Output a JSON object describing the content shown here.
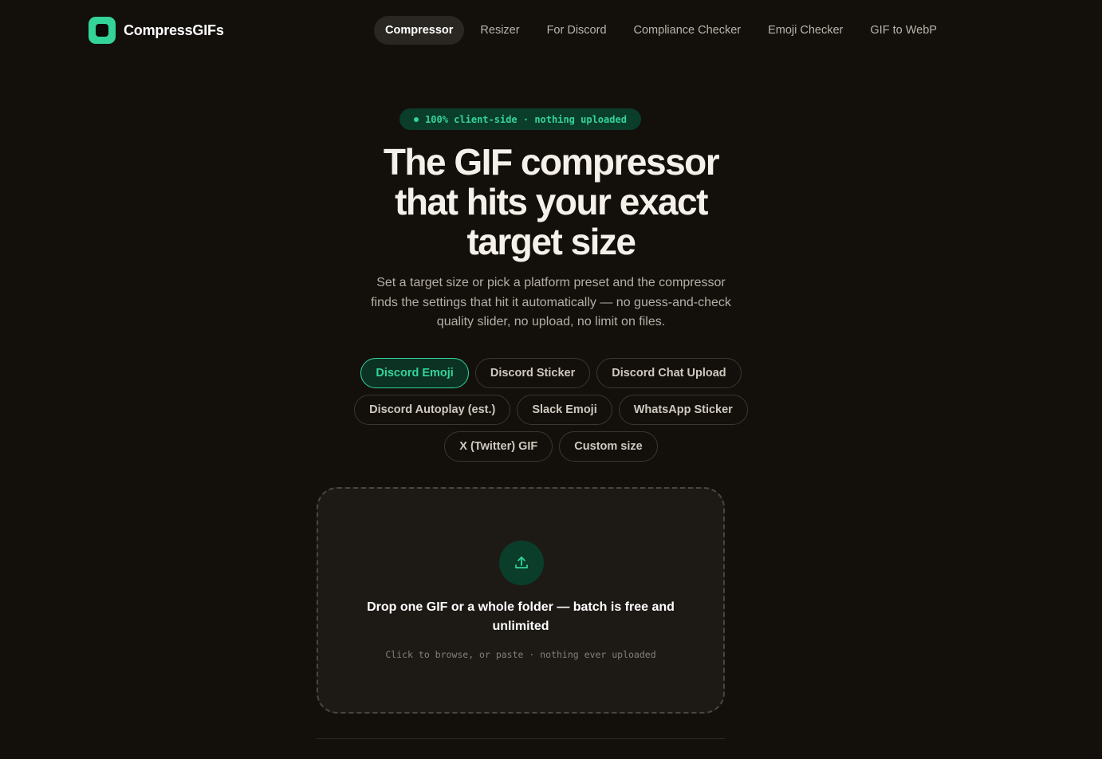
{
  "brand": {
    "name": "CompressGIFs",
    "accent": "#34d399"
  },
  "nav": {
    "items": [
      {
        "label": "Compressor",
        "active": true
      },
      {
        "label": "Resizer",
        "active": false
      },
      {
        "label": "For Discord",
        "active": false
      },
      {
        "label": "Compliance Checker",
        "active": false
      },
      {
        "label": "Emoji Checker",
        "active": false
      },
      {
        "label": "GIF to WebP",
        "active": false
      }
    ]
  },
  "hero": {
    "badge": "100% client-side · nothing uploaded",
    "title_lines": [
      "The GIF compressor",
      "that hits your exact",
      "target size"
    ],
    "subtitle_lines": [
      "Set a target size or pick a platform preset and the compressor",
      "finds the settings that hit it automatically — no guess-and-check",
      "quality slider, no upload, no limit on files."
    ]
  },
  "presets": {
    "rows": [
      [
        "Discord Emoji",
        "Discord Sticker",
        "Discord Chat Upload"
      ],
      [
        "Discord Autoplay (est.)",
        "Slack Emoji",
        "WhatsApp Sticker"
      ],
      [
        "X (Twitter) GIF",
        "Custom size"
      ]
    ],
    "selected": "Discord Emoji"
  },
  "dropzone": {
    "icon": "upload-icon",
    "title_lines": [
      "Drop one GIF or a whole folder — batch is free and",
      "unlimited"
    ],
    "hint": "Click to browse, or paste · nothing ever uploaded"
  },
  "colors": {
    "background": "#13100c",
    "accent": "#34d399",
    "accent_bg": "#0b3d2b"
  }
}
